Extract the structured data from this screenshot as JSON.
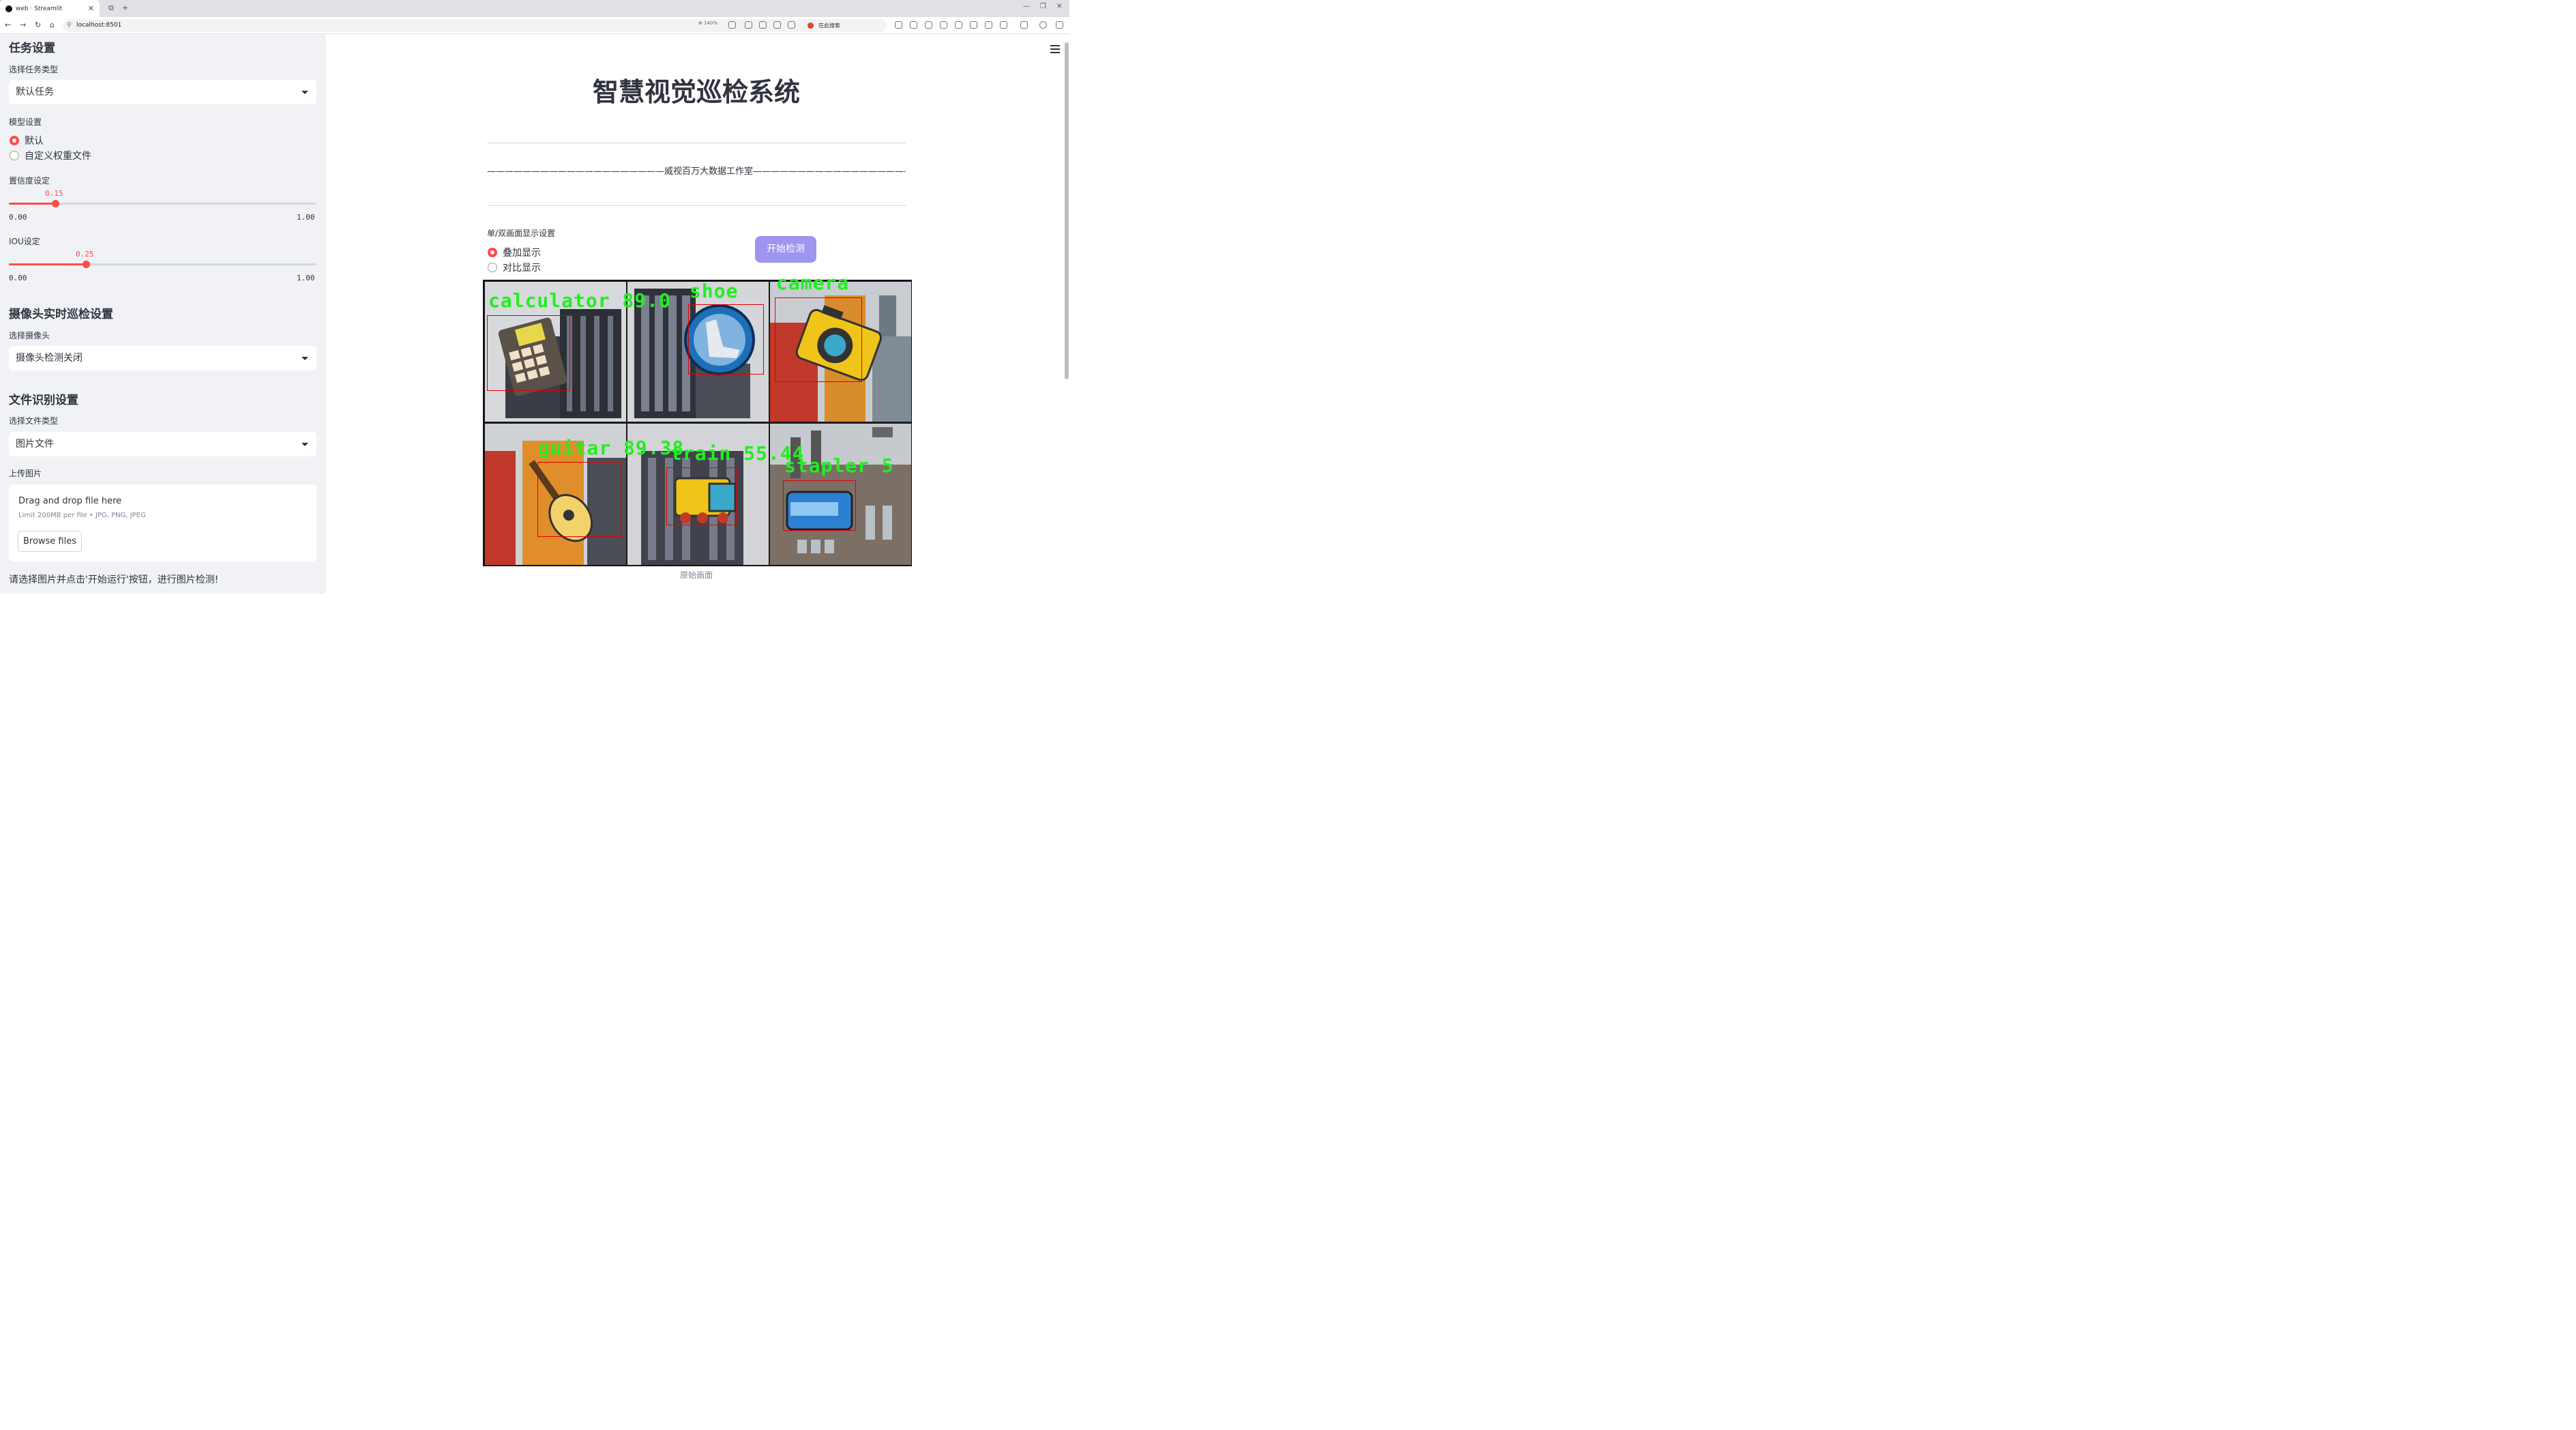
{
  "browser": {
    "tab_title": "web · Streamlit",
    "url": "localhost:8501",
    "zoom": "140%",
    "search_placeholder": "在此搜索"
  },
  "sidebar": {
    "task_heading": "任务设置",
    "task_type_label": "选择任务类型",
    "task_type_value": "默认任务",
    "model_label": "模型设置",
    "model_options": [
      "默认",
      "自定义权重文件"
    ],
    "model_selected": "默认",
    "conf_label": "置信度设定",
    "conf_value": "0.15",
    "conf_fraction": 0.15,
    "iou_label": "IOU设定",
    "iou_value": "0.25",
    "iou_fraction": 0.25,
    "slider_min": "0.00",
    "slider_max": "1.00",
    "camera_heading": "摄像头实时巡检设置",
    "camera_label": "选择摄像头",
    "camera_value": "摄像头检测关闭",
    "file_heading": "文件识别设置",
    "file_type_label": "选择文件类型",
    "file_type_value": "图片文件",
    "upload_label": "上传图片",
    "drop_text": "Drag and drop file here",
    "limit_text": "Limit 200MB per file • JPG, PNG, JPEG",
    "browse_label": "Browse files",
    "note": "请选择图片并点击'开始运行'按钮，进行图片检测!"
  },
  "main": {
    "title": "智慧视觉巡检系统",
    "studio_line": "————————————————————威视百万大数据工作室————————————————————",
    "display_label": "单/双画面显示设置",
    "display_options": [
      "叠加显示",
      "对比显示"
    ],
    "display_selected": "叠加显示",
    "start_button": "开始检测",
    "caption": "原始画面",
    "detections": [
      "calculator 89.0",
      "shoe",
      "camera",
      "guitar 89.38",
      "train 55.44",
      "stapler 5"
    ]
  }
}
